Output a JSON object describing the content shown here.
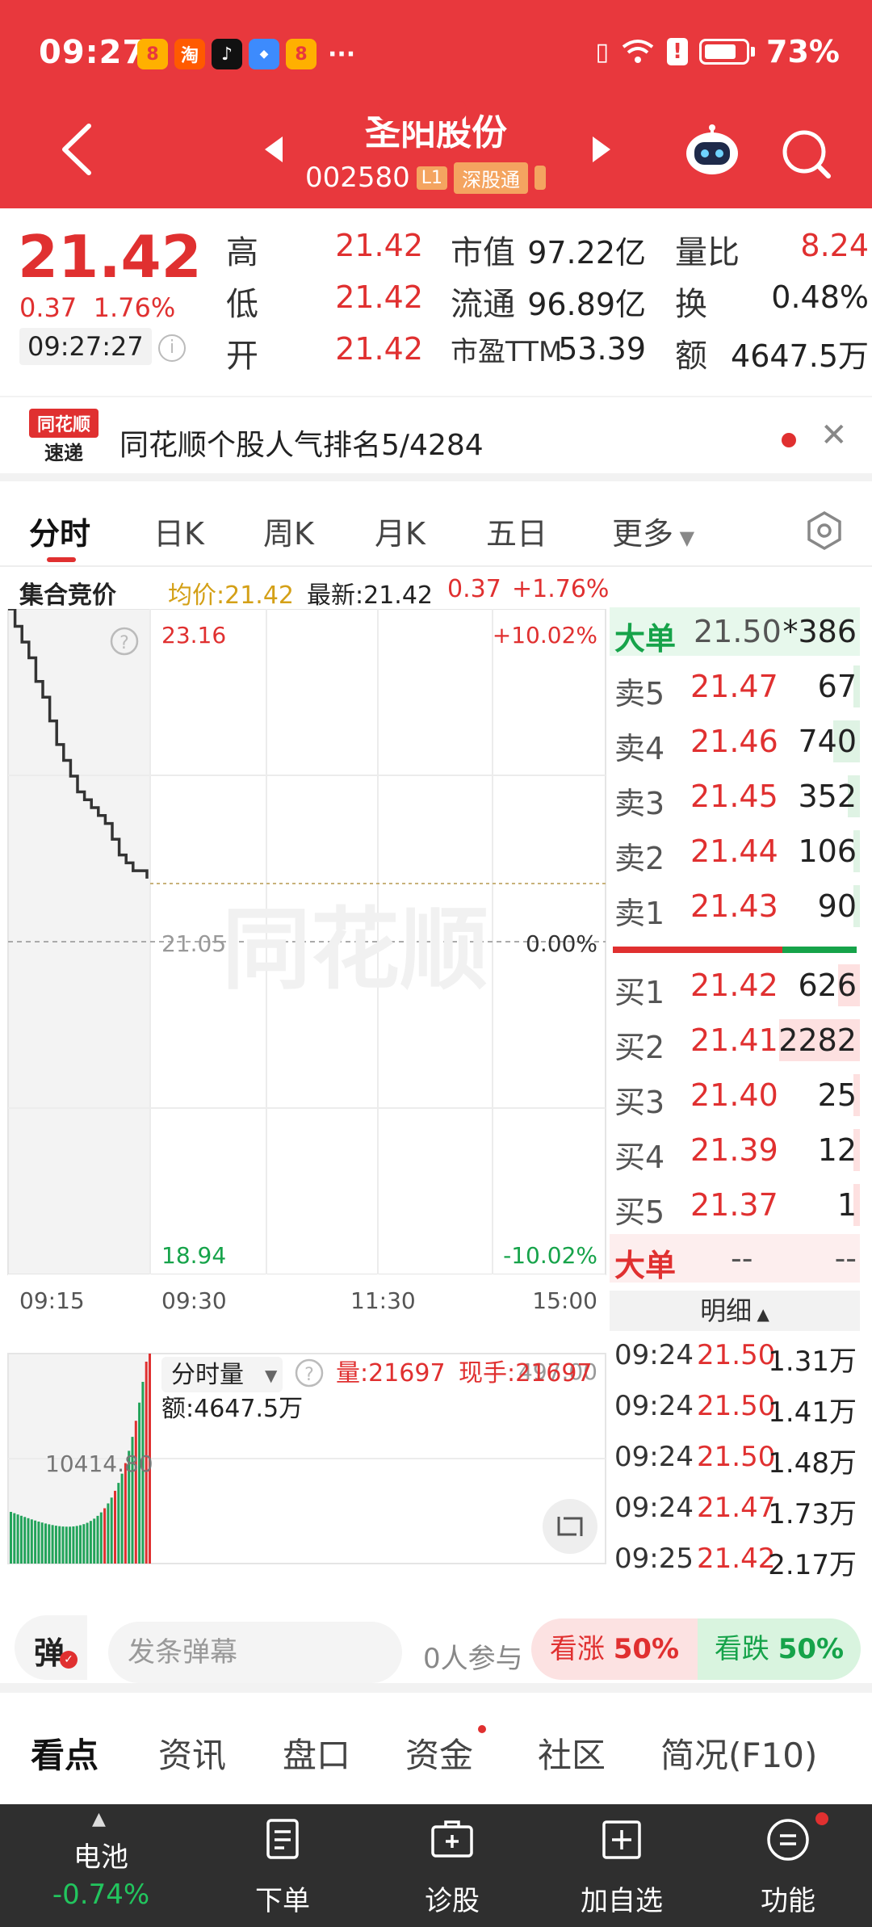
{
  "status_bar": {
    "time": "09:27",
    "battery": "73%",
    "more": "···",
    "app_taobao": "淘"
  },
  "header": {
    "stock_name": "圣阳股份",
    "stock_code": "002580",
    "tag_level": "L1",
    "tag_connect": "深股通"
  },
  "quote": {
    "price": "21.42",
    "change": "0.37",
    "change_pct": "1.76%",
    "time": "09:27:27",
    "high_label": "高",
    "high": "21.42",
    "low_label": "低",
    "low": "21.42",
    "open_label": "开",
    "open": "21.42",
    "mktcap_label": "市值",
    "mktcap": "97.22亿",
    "float_label": "流通",
    "float": "96.89亿",
    "pe_label": "市盈TTM",
    "pe": "53.39",
    "volratio_label": "量比",
    "volratio": "8.24",
    "turnover_label": "换",
    "turnover": "0.48%",
    "amount_label": "额",
    "amount": "4647.5万"
  },
  "banner": {
    "logo_top": "同花顺",
    "logo_bottom": "速递",
    "text": "同花顺个股人气排名5/4284"
  },
  "tabs": [
    "分时",
    "日K",
    "周K",
    "月K",
    "五日",
    "更多"
  ],
  "chart_data": {
    "type": "line",
    "title": "集合竞价",
    "avg_label": "均价:21.42",
    "latest_label": "最新:21.42",
    "legend_change": "0.37",
    "legend_pct": "+1.76%",
    "y_top": "23.16",
    "y_mid": "21.05",
    "y_bottom": "18.94",
    "pct_top": "+10.02%",
    "pct_mid": "0.00%",
    "pct_bottom": "-10.02%",
    "x_ticks": [
      "09:15",
      "09:30",
      "11:30",
      "15:00"
    ],
    "ylim": [
      18.94,
      23.16
    ],
    "watermark": "同花顺",
    "auction_series": {
      "name": "集合竞价",
      "points": [
        [
          0.0,
          23.16
        ],
        [
          0.05,
          23.05
        ],
        [
          0.1,
          22.95
        ],
        [
          0.15,
          22.85
        ],
        [
          0.2,
          22.7
        ],
        [
          0.25,
          22.6
        ],
        [
          0.3,
          22.45
        ],
        [
          0.35,
          22.3
        ],
        [
          0.4,
          22.2
        ],
        [
          0.45,
          22.1
        ],
        [
          0.5,
          22.0
        ],
        [
          0.55,
          21.95
        ],
        [
          0.6,
          21.9
        ],
        [
          0.65,
          21.85
        ],
        [
          0.7,
          21.8
        ],
        [
          0.75,
          21.7
        ],
        [
          0.8,
          21.6
        ],
        [
          0.85,
          21.55
        ],
        [
          0.9,
          21.5
        ],
        [
          1.0,
          21.45
        ]
      ]
    },
    "volume": {
      "label": "分时量",
      "amount_label": "额:4647.5万",
      "vol_label": "量:21697",
      "hand_label": "现手:21697",
      "side_value": "10414.80",
      "top_value": "497.00"
    }
  },
  "orderbook": {
    "big_label": "大单",
    "big_price": "21.50",
    "big_vol": "*386",
    "asks": [
      {
        "label": "卖5",
        "price": "21.47",
        "vol": "67",
        "ratio": 0.03
      },
      {
        "label": "卖4",
        "price": "21.46",
        "vol": "740",
        "ratio": 0.33
      },
      {
        "label": "卖3",
        "price": "21.45",
        "vol": "352",
        "ratio": 0.15
      },
      {
        "label": "卖2",
        "price": "21.44",
        "vol": "106",
        "ratio": 0.05
      },
      {
        "label": "卖1",
        "price": "21.43",
        "vol": "90",
        "ratio": 0.04
      }
    ],
    "bids": [
      {
        "label": "买1",
        "price": "21.42",
        "vol": "626",
        "ratio": 0.27
      },
      {
        "label": "买2",
        "price": "21.41",
        "vol": "2282",
        "ratio": 1.0
      },
      {
        "label": "买3",
        "price": "21.40",
        "vol": "25",
        "ratio": 0.01
      },
      {
        "label": "买4",
        "price": "21.39",
        "vol": "12",
        "ratio": 0.005
      },
      {
        "label": "买5",
        "price": "21.37",
        "vol": "1",
        "ratio": 0.002
      }
    ],
    "big2_label": "大单",
    "big2_a": "--",
    "big2_b": "--",
    "detail_label": "明细",
    "details": [
      {
        "t": "09:24",
        "p": "21.50",
        "v": "1.31万"
      },
      {
        "t": "09:24",
        "p": "21.50",
        "v": "1.41万"
      },
      {
        "t": "09:24",
        "p": "21.50",
        "v": "1.48万"
      },
      {
        "t": "09:24",
        "p": "21.47",
        "v": "1.73万"
      },
      {
        "t": "09:25",
        "p": "21.42",
        "v": "2.17万"
      }
    ]
  },
  "danmaku": {
    "icon_text": "弹",
    "placeholder": "发条弹幕",
    "count": "0人参与",
    "up_label": "看涨",
    "up_pct": "50%",
    "down_label": "看跌",
    "down_pct": "50%"
  },
  "bottom_tabs": [
    "看点",
    "资讯",
    "盘口",
    "资金",
    "社区",
    "简况(F10)"
  ],
  "bottom_nav": {
    "battery_label": "电池",
    "battery_change": "-0.74%",
    "items": [
      "下单",
      "诊股",
      "加自选",
      "功能"
    ]
  },
  "colors": {
    "header_red": "#e8383d",
    "up": "#e03030",
    "down": "#16a34a",
    "avg": "#d4a017"
  }
}
